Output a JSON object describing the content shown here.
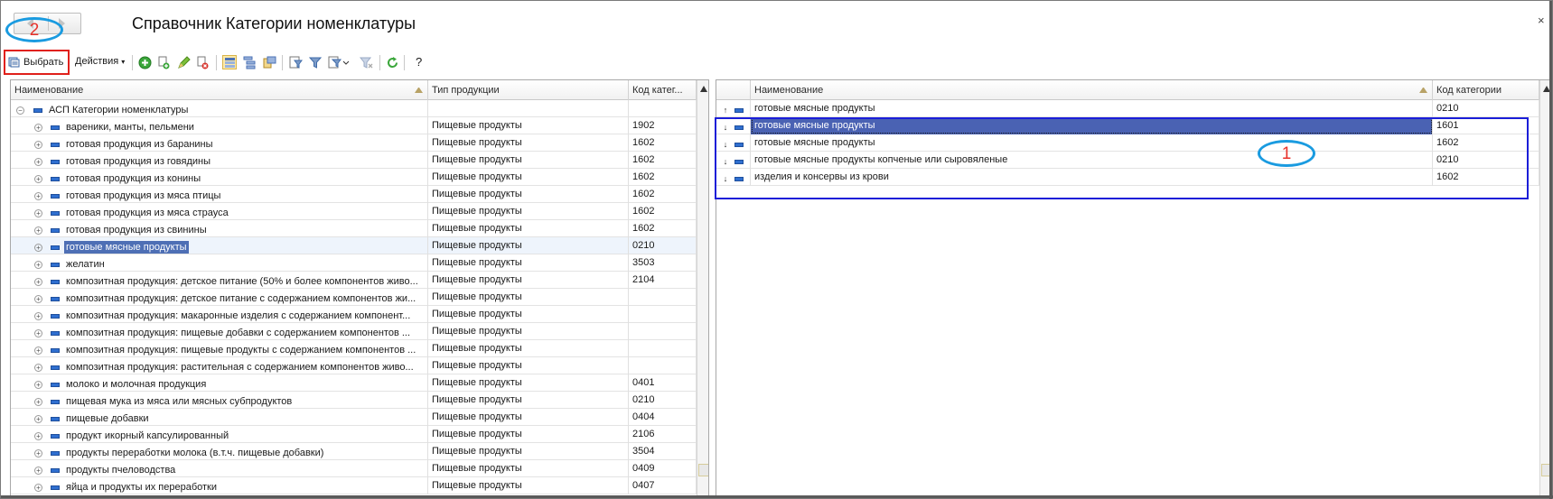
{
  "window": {
    "title": "Справочник Категории номенклатуры",
    "close_glyph": "×"
  },
  "annotations": {
    "oval_1": "1",
    "oval_2": "2"
  },
  "toolbar": {
    "select_label": "Выбрать",
    "actions_label": "Действия",
    "help_label": "?"
  },
  "icons": [
    "select-icon",
    "add-icon",
    "copy-icon",
    "edit-icon",
    "delete-icon",
    "list-mode-icon",
    "hierarchy-icon",
    "tree-icon",
    "filter-icon",
    "filter-by-value-icon",
    "sort-icon",
    "clear-filter-icon",
    "refresh-icon"
  ],
  "left_table": {
    "columns": [
      "Наименование",
      "Тип продукции",
      "Код катег..."
    ],
    "root_label": "АСП Категории номенклатуры",
    "rows": [
      {
        "name": "вареники, манты, пельмени",
        "type": "Пищевые продукты",
        "code": "1902"
      },
      {
        "name": "готовая продукция из баранины",
        "type": "Пищевые продукты",
        "code": "1602"
      },
      {
        "name": "готовая продукция из говядины",
        "type": "Пищевые продукты",
        "code": "1602"
      },
      {
        "name": "готовая продукция из конины",
        "type": "Пищевые продукты",
        "code": "1602"
      },
      {
        "name": "готовая продукция из мяса птицы",
        "type": "Пищевые продукты",
        "code": "1602"
      },
      {
        "name": "готовая продукция из мяса страуса",
        "type": "Пищевые продукты",
        "code": "1602"
      },
      {
        "name": "готовая продукция из свинины",
        "type": "Пищевые продукты",
        "code": "1602"
      },
      {
        "name": "готовые мясные продукты",
        "type": "Пищевые продукты",
        "code": "0210"
      },
      {
        "name": "желатин",
        "type": "Пищевые продукты",
        "code": "3503"
      },
      {
        "name": "композитная продукция: детское питание (50% и более компонентов живо...",
        "type": "Пищевые продукты",
        "code": "2104"
      },
      {
        "name": "композитная продукция: детское питание с содержанием компонентов жи...",
        "type": "Пищевые продукты",
        "code": ""
      },
      {
        "name": "композитная продукция: макаронные изделия с содержанием компонент...",
        "type": "Пищевые продукты",
        "code": ""
      },
      {
        "name": "композитная продукция: пищевые добавки с содержанием компонентов ...",
        "type": "Пищевые продукты",
        "code": ""
      },
      {
        "name": "композитная продукция: пищевые продукты с содержанием компонентов ...",
        "type": "Пищевые продукты",
        "code": ""
      },
      {
        "name": "композитная продукция: растительная с содержанием компонентов живо...",
        "type": "Пищевые продукты",
        "code": ""
      },
      {
        "name": "молоко и молочная продукция",
        "type": "Пищевые продукты",
        "code": "0401"
      },
      {
        "name": "пищевая мука из мяса или мясных субпродуктов",
        "type": "Пищевые продукты",
        "code": "0210"
      },
      {
        "name": "пищевые добавки",
        "type": "Пищевые продукты",
        "code": "0404"
      },
      {
        "name": "продукт икорный капсулированный",
        "type": "Пищевые продукты",
        "code": "2106"
      },
      {
        "name": "продукты переработки молока (в.т.ч. пищевые добавки)",
        "type": "Пищевые продукты",
        "code": "3504"
      },
      {
        "name": "продукты пчеловодства",
        "type": "Пищевые продукты",
        "code": "0409"
      },
      {
        "name": "яйца и продукты их переработки",
        "type": "Пищевые продукты",
        "code": "0407"
      }
    ]
  },
  "right_table": {
    "columns": [
      "Наименование",
      "Код категории"
    ],
    "rows": [
      {
        "name": "готовые мясные продукты",
        "code": "0210",
        "arrow": "up"
      },
      {
        "name": "готовые мясные продукты",
        "code": "1601",
        "arrow": "down"
      },
      {
        "name": "готовые мясные продукты",
        "code": "1602",
        "arrow": "down"
      },
      {
        "name": "готовые мясные продукты копченые или сыровяленые",
        "code": "0210",
        "arrow": "down"
      },
      {
        "name": "изделия и консервы из крови",
        "code": "1602",
        "arrow": "down"
      }
    ]
  }
}
